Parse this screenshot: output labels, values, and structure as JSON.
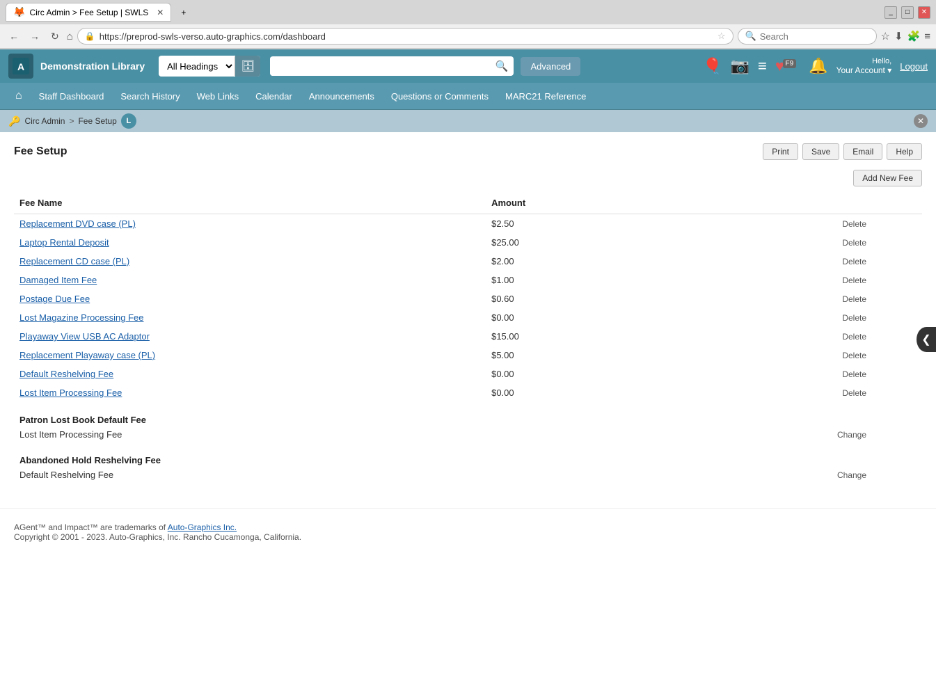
{
  "browser": {
    "tab_title": "Circ Admin > Fee Setup | SWLS",
    "tab_new": "+",
    "address": "https://preprod-swls-verso.auto-graphics.com/dashboard",
    "search_placeholder": "Search",
    "nav_back": "←",
    "nav_forward": "→",
    "nav_refresh": "↻"
  },
  "header": {
    "library_name": "Demonstration Library",
    "search_type": "All Headings",
    "search_placeholder": "",
    "advanced_label": "Advanced",
    "hello_label": "Hello,",
    "account_label": "Your Account",
    "logout_label": "Logout",
    "f9_badge": "F9"
  },
  "nav": {
    "home_icon": "⌂",
    "items": [
      {
        "label": "Staff Dashboard"
      },
      {
        "label": "Search History"
      },
      {
        "label": "Web Links"
      },
      {
        "label": "Calendar"
      },
      {
        "label": "Announcements"
      },
      {
        "label": "Questions or Comments"
      },
      {
        "label": "MARC21 Reference"
      }
    ]
  },
  "breadcrumb": {
    "icon": "🔑",
    "circ_admin": "Circ Admin",
    "separator": ">",
    "fee_setup": "Fee Setup",
    "user_initial": "L"
  },
  "page": {
    "title": "Fee Setup",
    "actions": {
      "print": "Print",
      "save": "Save",
      "email": "Email",
      "help": "Help",
      "add_new": "Add New Fee"
    }
  },
  "table": {
    "col_fee_name": "Fee Name",
    "col_amount": "Amount",
    "fees": [
      {
        "name": "Replacement DVD case (PL)",
        "amount": "$2.50",
        "action": "Delete"
      },
      {
        "name": "Laptop Rental Deposit",
        "amount": "$25.00",
        "action": "Delete"
      },
      {
        "name": "Replacement CD case (PL)",
        "amount": "$2.00",
        "action": "Delete"
      },
      {
        "name": "Damaged Item Fee",
        "amount": "$1.00",
        "action": "Delete"
      },
      {
        "name": "Postage Due Fee",
        "amount": "$0.60",
        "action": "Delete"
      },
      {
        "name": "Lost Magazine Processing Fee",
        "amount": "$0.00",
        "action": "Delete"
      },
      {
        "name": "Playaway View USB AC Adaptor",
        "amount": "$15.00",
        "action": "Delete"
      },
      {
        "name": "Replacement Playaway case (PL)",
        "amount": "$5.00",
        "action": "Delete"
      },
      {
        "name": "Default Reshelving Fee",
        "amount": "$0.00",
        "action": "Delete"
      },
      {
        "name": "Lost Item Processing Fee",
        "amount": "$0.00",
        "action": "Delete"
      }
    ],
    "patron_lost_book_section_title": "Patron Lost Book Default Fee",
    "patron_lost_book_value": "Lost Item Processing Fee",
    "patron_lost_book_action": "Change",
    "abandoned_hold_section_title": "Abandoned Hold Reshelving Fee",
    "abandoned_hold_value": "Default Reshelving Fee",
    "abandoned_hold_action": "Change"
  },
  "footer": {
    "trademark": "AGent™ and Impact™ are trademarks of ",
    "link_text": "Auto-Graphics Inc.",
    "link_url": "#",
    "copyright": "Copyright © 2001 - 2023. Auto-Graphics, Inc. Rancho Cucamonga, California."
  },
  "sidebar_toggle": "❮"
}
